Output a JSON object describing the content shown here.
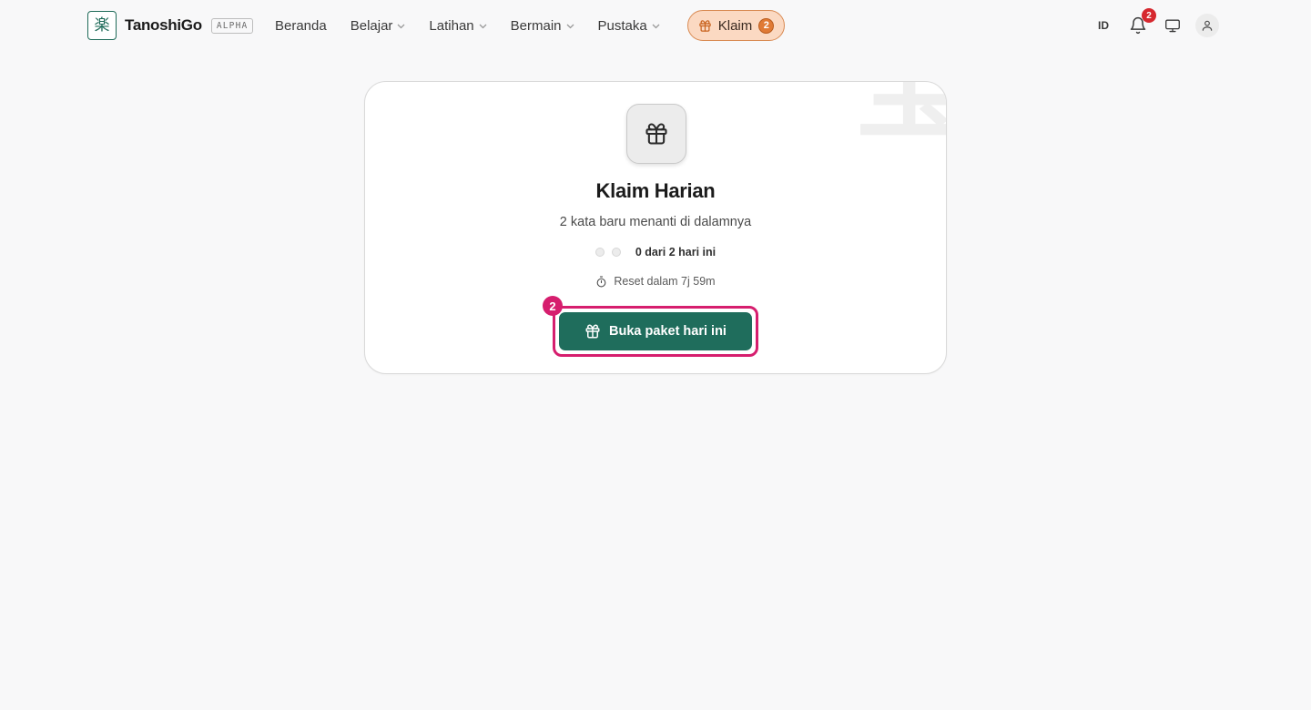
{
  "brand": {
    "logo_glyph": "楽",
    "name": "TanoshiGo",
    "badge": "ALPHA",
    "accent": "#1f6b59"
  },
  "nav": {
    "items": [
      {
        "label": "Beranda",
        "dropdown": false
      },
      {
        "label": "Belajar",
        "dropdown": true
      },
      {
        "label": "Latihan",
        "dropdown": true
      },
      {
        "label": "Bermain",
        "dropdown": true
      },
      {
        "label": "Pustaka",
        "dropdown": true
      }
    ],
    "klaim": {
      "label": "Klaim",
      "count": "2",
      "icon": "gift-icon",
      "color": "#fbd9c2"
    }
  },
  "tools": {
    "language": "ID",
    "notifications_count": "2",
    "icons": [
      "bell-icon",
      "monitor-icon",
      "user-icon"
    ]
  },
  "card": {
    "watermark_glyph": "宝",
    "icon": "gift-icon",
    "title": "Klaim Harian",
    "subtitle": "2 kata baru menanti di dalamnya",
    "progress": {
      "done": 0,
      "total": 2,
      "label": "0 dari 2 hari ini"
    },
    "reset": {
      "icon": "timer-icon",
      "label": "Reset dalam 7j 59m"
    },
    "cta": {
      "label": "Buka paket hari ini",
      "icon": "gift-icon",
      "color": "#1f6d5c"
    },
    "marker": {
      "number": "2",
      "color": "#d61e6e"
    }
  }
}
